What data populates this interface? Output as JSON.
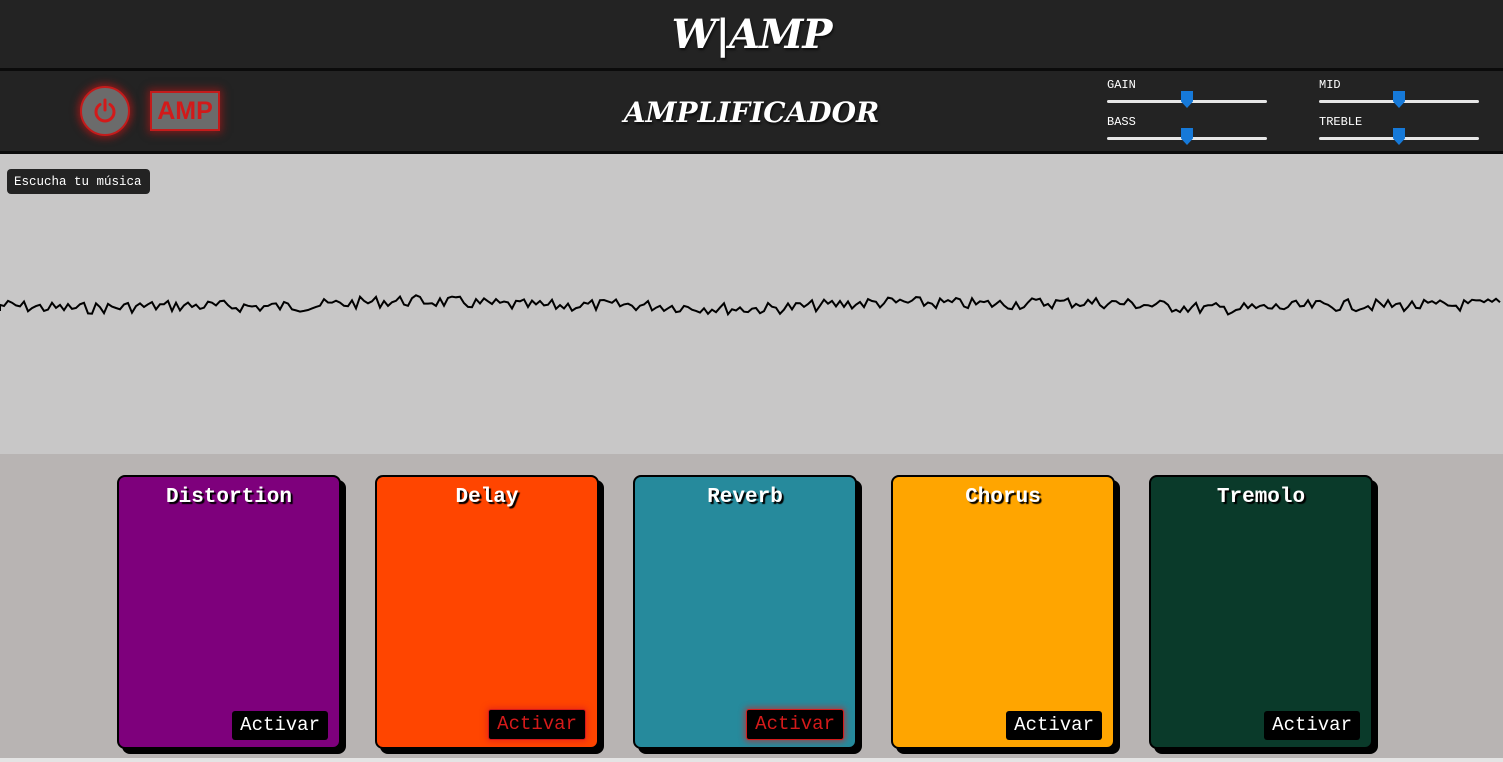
{
  "header": {
    "brand": "W|AMP"
  },
  "amp": {
    "title": "AMPLIFICADOR",
    "power_icon": "power-icon",
    "amp_button": "AMP",
    "accent_color": "#d21a1a",
    "knobs": [
      {
        "label": "GAIN",
        "value": 0.5
      },
      {
        "label": "MID",
        "value": 0.5
      },
      {
        "label": "BASS",
        "value": 0.5
      },
      {
        "label": "TREBLE",
        "value": 0.5
      }
    ]
  },
  "visualizer": {
    "listen_button": "Escucha tu música"
  },
  "pedals": [
    {
      "name": "Distortion",
      "action": "Activar",
      "color": "#7e007c",
      "active": false
    },
    {
      "name": "Delay",
      "action": "Activar",
      "color": "#ff4500",
      "active": true
    },
    {
      "name": "Reverb",
      "action": "Activar",
      "color": "#268a9c",
      "active": true
    },
    {
      "name": "Chorus",
      "action": "Activar",
      "color": "#ffa500",
      "active": false
    },
    {
      "name": "Tremolo",
      "action": "Activar",
      "color": "#0a3a2a",
      "active": false
    }
  ]
}
